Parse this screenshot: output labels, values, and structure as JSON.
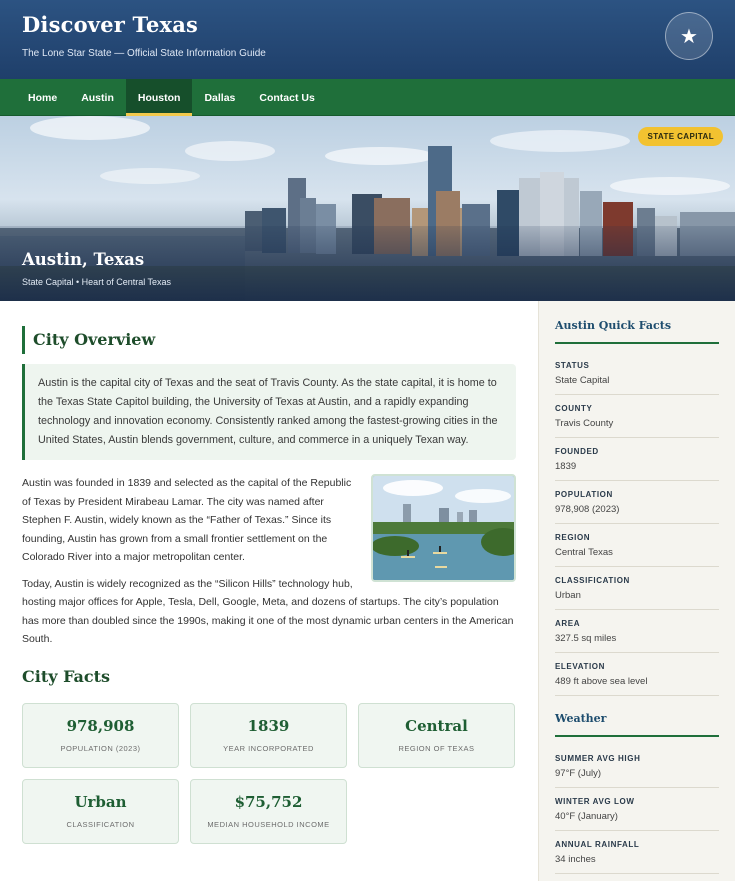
{
  "header": {
    "title": "Discover Texas",
    "tagline": "The Lone Star State — Official State Information Guide",
    "badge_icon": "star-icon"
  },
  "nav": {
    "items": [
      {
        "label": "Home"
      },
      {
        "label": "Austin"
      },
      {
        "label": "Houston",
        "active": true
      },
      {
        "label": "Dallas"
      },
      {
        "label": "Contact Us"
      }
    ]
  },
  "hero": {
    "badge": "STATE CAPITAL",
    "title": "Austin, Texas",
    "subtitle": "State Capital • Heart of Central Texas"
  },
  "overview": {
    "heading": "City Overview",
    "callout": "Austin is the capital city of Texas and the seat of Travis County. As the state capital, it is home to the Texas State Capitol building, the University of Texas at Austin, and a rapidly expanding technology and innovation economy. Consistently ranked among the fastest-growing cities in the United States, Austin blends government, culture, and commerce in a uniquely Texan way.",
    "paragraph1": "Austin was founded in 1839 and selected as the capital of the Republic of Texas by President Mirabeau Lamar. The city was named after Stephen F. Austin, widely known as the “Father of Texas.” Since its founding, Austin has grown from a small frontier settlement on the Colorado River into a major metropolitan center.",
    "paragraph2": "Today, Austin is widely recognized as the “Silicon Hills” technology hub, hosting major offices for Apple, Tesla, Dell, Google, Meta, and dozens of startups. The city’s population has more than doubled since the 1990s, making it one of the most dynamic urban centers in the American South."
  },
  "city_facts": {
    "heading": "City Facts",
    "cards": [
      {
        "value": "978,908",
        "label": "POPULATION (2023)"
      },
      {
        "value": "1839",
        "label": "YEAR INCORPORATED"
      },
      {
        "value": "Central",
        "label": "REGION OF TEXAS"
      },
      {
        "value": "Urban",
        "label": "CLASSIFICATION"
      },
      {
        "value": "$75,752",
        "label": "MEDIAN HOUSEHOLD INCOME"
      }
    ]
  },
  "sidebar": {
    "quick_facts_heading": "Austin Quick Facts",
    "quick_facts": [
      {
        "label": "STATUS",
        "value": "State Capital"
      },
      {
        "label": "COUNTY",
        "value": "Travis County"
      },
      {
        "label": "FOUNDED",
        "value": "1839"
      },
      {
        "label": "POPULATION",
        "value": "978,908 (2023)"
      },
      {
        "label": "REGION",
        "value": "Central Texas"
      },
      {
        "label": "CLASSIFICATION",
        "value": "Urban"
      },
      {
        "label": "AREA",
        "value": "327.5 sq miles"
      },
      {
        "label": "ELEVATION",
        "value": "489 ft above sea level"
      }
    ],
    "weather_heading": "Weather",
    "weather": [
      {
        "label": "SUMMER AVG HIGH",
        "value": "97°F (July)"
      },
      {
        "label": "WINTER AVG LOW",
        "value": "40°F (January)"
      },
      {
        "label": "ANNUAL RAINFALL",
        "value": "34 inches"
      }
    ]
  },
  "colors": {
    "header_blue": "#2c5382",
    "nav_green": "#1f6f3a",
    "accent_gold": "#f2c230"
  }
}
